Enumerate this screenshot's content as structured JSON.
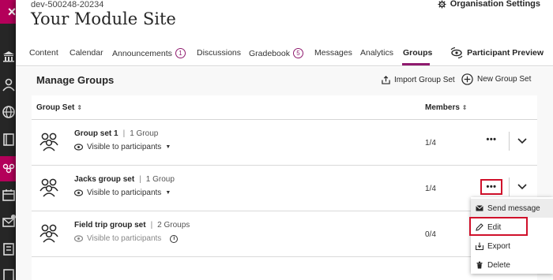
{
  "header": {
    "course_id": "dev-500248-20234",
    "title": "Your Module Site",
    "org_settings_label": "Organisation Settings"
  },
  "rail": {
    "close_label": "×"
  },
  "tabs": [
    {
      "label": "Content"
    },
    {
      "label": "Calendar"
    },
    {
      "label": "Announcements",
      "badge": "1"
    },
    {
      "label": "Discussions"
    },
    {
      "label": "Gradebook",
      "badge": "5"
    },
    {
      "label": "Messages"
    },
    {
      "label": "Analytics"
    },
    {
      "label": "Groups",
      "active": true
    }
  ],
  "participant_preview_label": "Participant Preview",
  "manage": {
    "title": "Manage Groups",
    "import_label": "Import Group Set",
    "new_label": "New Group Set"
  },
  "table": {
    "col_group_set": "Group Set",
    "col_members": "Members",
    "sort_symbol": "⇕",
    "separator": "|",
    "more_symbol": "•••",
    "rows": [
      {
        "name": "Group set 1",
        "count": "1 Group",
        "visibility": "Visible to participants",
        "members": "1/4"
      },
      {
        "name": "Jacks group set",
        "count": "1 Group",
        "visibility": "Visible to participants",
        "members": "1/4"
      },
      {
        "name": "Field trip group set",
        "count": "2 Groups",
        "visibility": "Visible to participants",
        "members": "0/4"
      }
    ]
  },
  "menu": {
    "items": [
      {
        "label": "Send message",
        "icon": "envelope-icon"
      },
      {
        "label": "Edit",
        "icon": "pencil-icon"
      },
      {
        "label": "Export",
        "icon": "export-icon"
      },
      {
        "label": "Delete",
        "icon": "trash-icon"
      }
    ]
  },
  "colors": {
    "accent": "#8f1a6e",
    "close": "#b4005a",
    "highlight": "#d0112b"
  }
}
